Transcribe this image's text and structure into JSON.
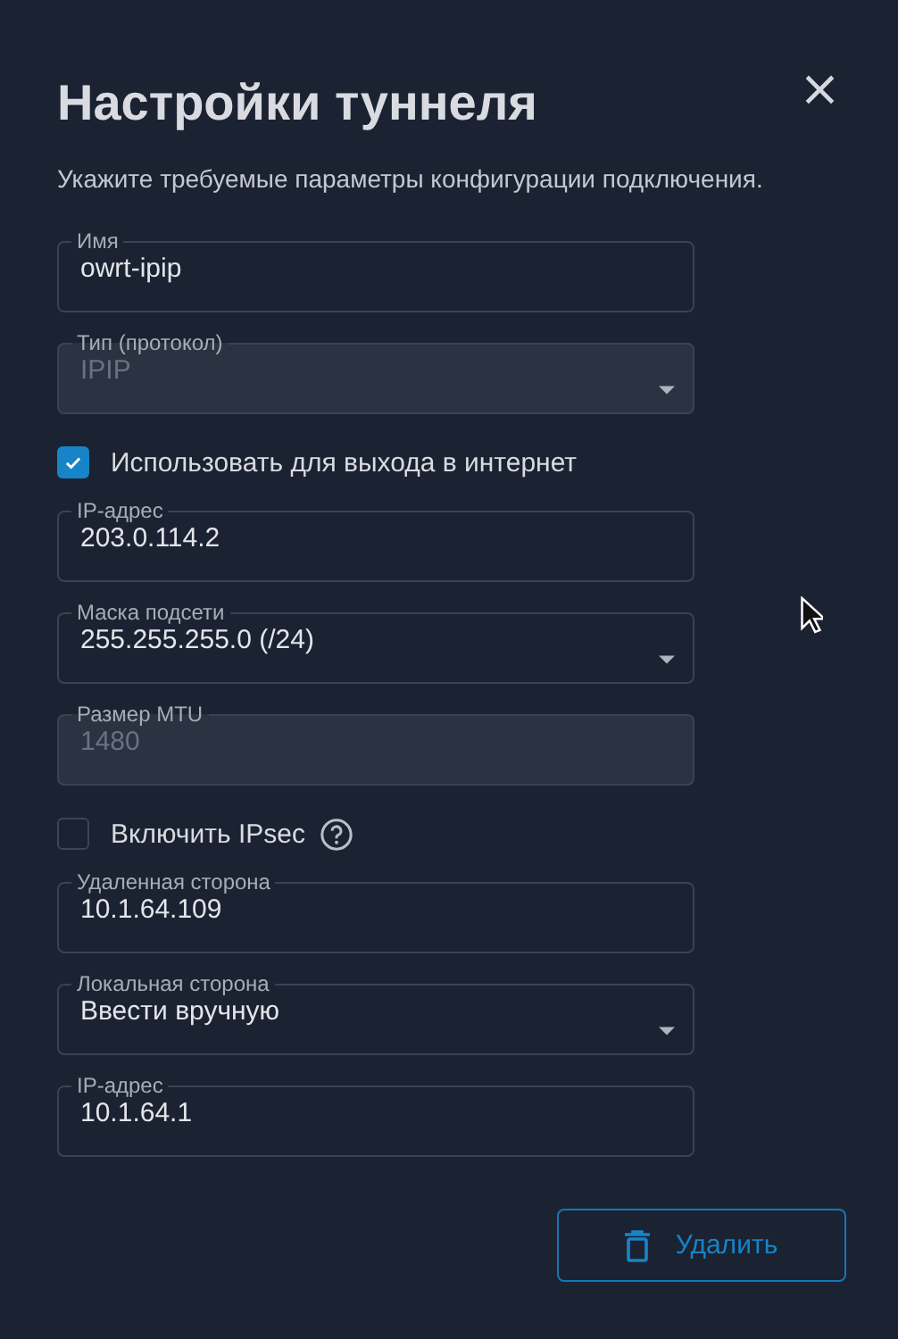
{
  "dialog": {
    "title": "Настройки туннеля",
    "subtitle": "Укажите требуемые параметры конфигурации подключения.",
    "close": "×"
  },
  "fields": [
    {
      "kind": "text",
      "label": "Имя",
      "value": "owrt-ipip",
      "disabled": false
    },
    {
      "kind": "select",
      "label": "Тип (протокол)",
      "value": "IPIP",
      "disabled": true
    },
    {
      "kind": "checkbox",
      "label": "Использовать для выхода в интернет",
      "checked": true,
      "help": false
    },
    {
      "kind": "text",
      "label": "IP-адрес",
      "value": "203.0.114.2",
      "disabled": false
    },
    {
      "kind": "select",
      "label": "Маска подсети",
      "value": "255.255.255.0 (/24)",
      "disabled": false
    },
    {
      "kind": "text",
      "label": "Размер MTU",
      "value": "1480",
      "disabled": true
    },
    {
      "kind": "checkbox",
      "label": "Включить IPsec",
      "checked": false,
      "help": true
    },
    {
      "kind": "text",
      "label": "Удаленная сторона",
      "value": "10.1.64.109",
      "disabled": false
    },
    {
      "kind": "select",
      "label": "Локальная сторона",
      "value": "Ввести вручную",
      "disabled": false
    },
    {
      "kind": "text",
      "label": "IP-адрес",
      "value": "10.1.64.1",
      "disabled": false
    }
  ],
  "delete_button": {
    "label": "Удалить"
  }
}
